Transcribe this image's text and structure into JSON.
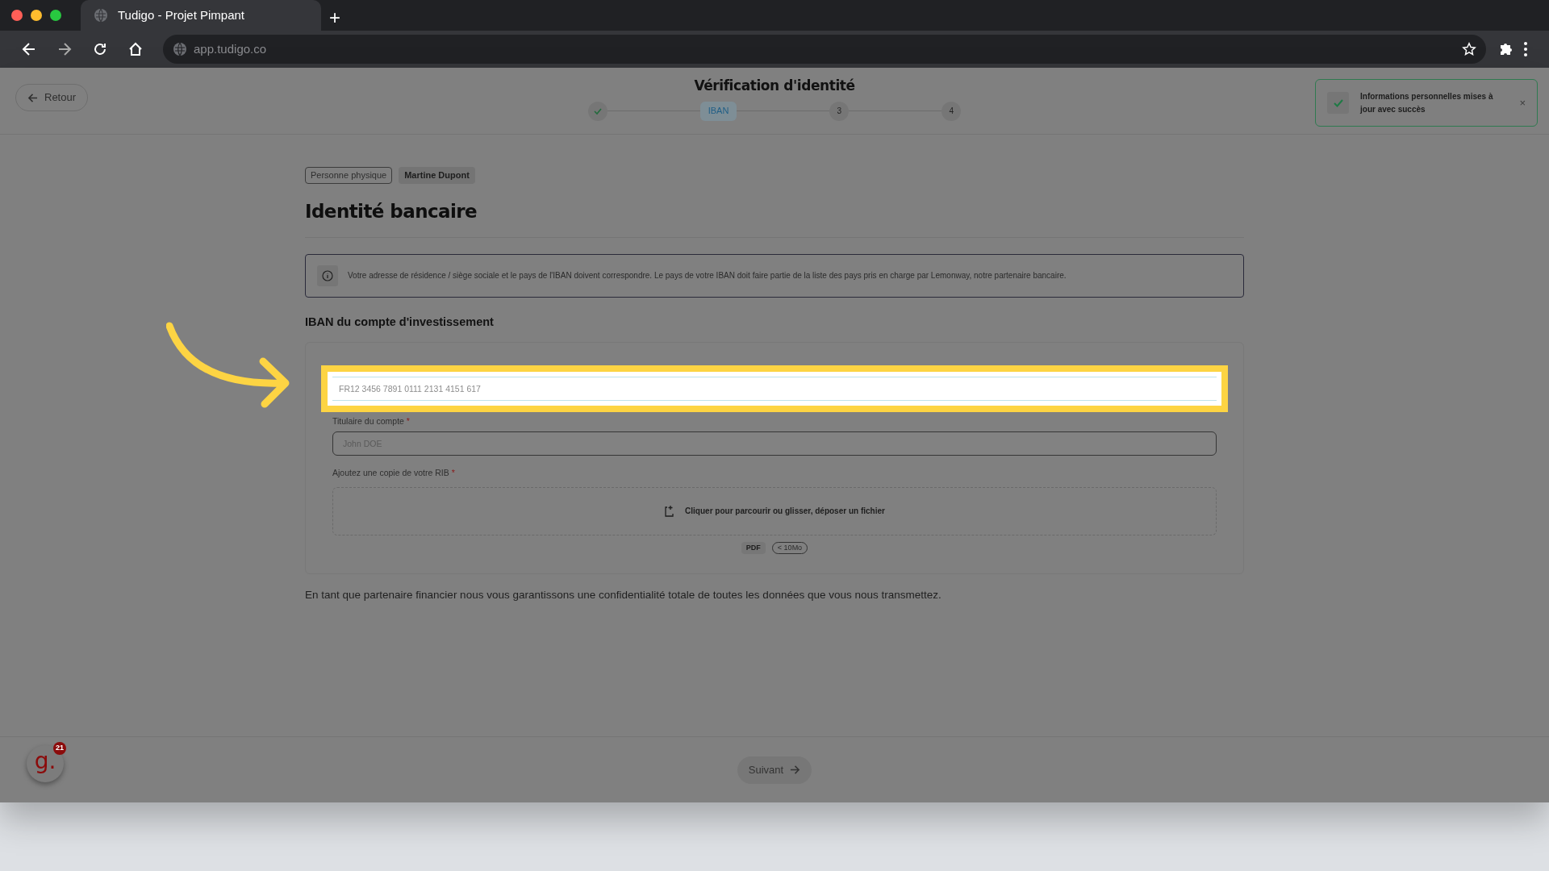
{
  "browser": {
    "tab_title": "Tudigo - Projet Pimpant",
    "new_tab": "+",
    "url": "app.tudigo.co"
  },
  "header": {
    "back": "Retour",
    "title": "Vérification d'identité",
    "steps": [
      {
        "kind": "done",
        "selected": false
      },
      {
        "kind": "current",
        "label": "IBAN",
        "selected": true
      },
      {
        "kind": "pending",
        "label": "3",
        "selected": false
      },
      {
        "kind": "pending",
        "label": "4",
        "selected": false
      }
    ]
  },
  "toast": {
    "text": "Informations personnelles mises à jour avec succès",
    "close": "×"
  },
  "tags": [
    {
      "label": "Personne physique",
      "kind": "outline"
    },
    {
      "label": "Martine Dupont",
      "kind": "filled"
    }
  ],
  "heading": "Identité bancaire",
  "info": "Votre adresse de résidence / siège sociale et le pays de l'IBAN doivent correspondre. Le pays de votre IBAN doit faire partie de la liste des pays pris en charge par Lemonway, notre partenaire bancaire.",
  "section_title": "IBAN du compte d'investissement",
  "fields": [
    {
      "placeholder": "FR12 3456 7891 0111 2131 4151 617",
      "highlighted": true
    },
    {
      "label": "Titulaire du compte",
      "required_mark": "*",
      "placeholder": "John DOE",
      "highlighted": false
    }
  ],
  "upload": {
    "label": "Ajoutez une copie de votre RIB",
    "required_mark": "*",
    "text": "Cliquer pour parcourir ou glisser, déposer un fichier",
    "formats": [
      {
        "label": "PDF",
        "kind": "filled"
      },
      {
        "label": "< 10Mo",
        "kind": "outline"
      }
    ]
  },
  "note": "En tant que partenaire financier nous vous garantissons une confidentialité totale de toutes les données que vous nous transmettez.",
  "footer": {
    "logo": "g.",
    "badge": "21",
    "next": "Suivant",
    "next_disabled": true
  }
}
